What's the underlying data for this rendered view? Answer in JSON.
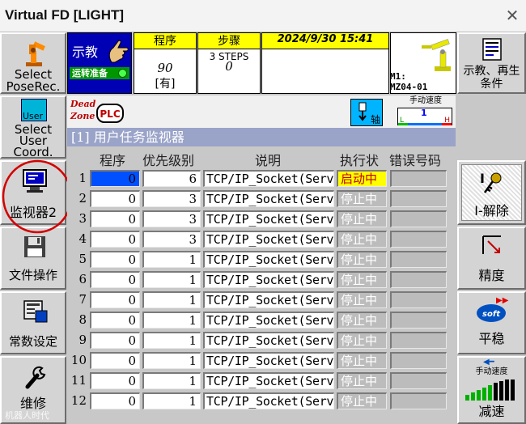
{
  "window": {
    "title": "Virtual FD [LIGHT]",
    "close_glyph": "✕"
  },
  "left_buttons": [
    {
      "label1": "Select",
      "label2": "PoseRec.",
      "icon": "robot-arm-icon"
    },
    {
      "label_icon": "User",
      "label1": "Select",
      "label2": "User",
      "label3": "Coord.",
      "icon": "user-coord-icon"
    },
    {
      "label1": "监视器2",
      "icon": "monitor-icon"
    },
    {
      "label1": "文件操作",
      "icon": "floppy-disk-icon"
    },
    {
      "label1": "常数设定",
      "icon": "constant-setting-icon"
    },
    {
      "label1": "维修",
      "icon": "wrench-icon"
    }
  ],
  "right_buttons": [
    {
      "label1": "示教、再生",
      "label2": "条件",
      "icon": "teach-condition-icon"
    },
    {
      "label1": "I-解除",
      "icon": "key-icon"
    },
    {
      "label1": "精度",
      "icon": "precision-icon"
    },
    {
      "label1": "平稳",
      "soft": "soft",
      "icon": "soft-icon"
    },
    {
      "label1": "手动速度",
      "label2": "减速",
      "icon": "speed-bars-icon"
    }
  ],
  "header": {
    "mode": "示教",
    "ready": "运转准备",
    "program_cap": "程序",
    "program_no": "90",
    "program_state": "[有]",
    "step_cap": "步骤",
    "steps": "3 STEPS",
    "step_no": "0",
    "datetime": "2024/9/30  15:41",
    "machine1": "M1:",
    "machine2": "MZ04-01"
  },
  "toolbar": {
    "deadzone1": "Dead",
    "deadzone2": "Zone",
    "plc": "PLC",
    "axis": "轴",
    "speed_label": "手动速度",
    "speed_l": "L",
    "speed_h": "H",
    "speed_value": "1"
  },
  "monitor": {
    "title": "[1] 用户任务监视器",
    "columns": {
      "program": "程序",
      "priority": "优先级别",
      "desc": "说明",
      "exec": "执行状",
      "err": "错误号码"
    },
    "rows": [
      {
        "n": "1",
        "program": "0",
        "priority": "6",
        "desc": "TCP/IP_Socket(Serv",
        "exec": "启动中",
        "err": ""
      },
      {
        "n": "2",
        "program": "0",
        "priority": "3",
        "desc": "TCP/IP_Socket(Serv",
        "exec": "停止中",
        "err": ""
      },
      {
        "n": "3",
        "program": "0",
        "priority": "3",
        "desc": "TCP/IP_Socket(Serv",
        "exec": "停止中",
        "err": ""
      },
      {
        "n": "4",
        "program": "0",
        "priority": "3",
        "desc": "TCP/IP_Socket(Serv",
        "exec": "停止中",
        "err": ""
      },
      {
        "n": "5",
        "program": "0",
        "priority": "1",
        "desc": "TCP/IP_Socket(Serv",
        "exec": "停止中",
        "err": ""
      },
      {
        "n": "6",
        "program": "0",
        "priority": "1",
        "desc": "TCP/IP_Socket(Serv",
        "exec": "停止中",
        "err": ""
      },
      {
        "n": "7",
        "program": "0",
        "priority": "1",
        "desc": "TCP/IP_Socket(Serv",
        "exec": "停止中",
        "err": ""
      },
      {
        "n": "8",
        "program": "0",
        "priority": "1",
        "desc": "TCP/IP_Socket(Serv",
        "exec": "停止中",
        "err": ""
      },
      {
        "n": "9",
        "program": "0",
        "priority": "1",
        "desc": "TCP/IP_Socket(Serv",
        "exec": "停止中",
        "err": ""
      },
      {
        "n": "10",
        "program": "0",
        "priority": "1",
        "desc": "TCP/IP_Socket(Serv",
        "exec": "停止中",
        "err": ""
      },
      {
        "n": "11",
        "program": "0",
        "priority": "1",
        "desc": "TCP/IP_Socket(Serv",
        "exec": "停止中",
        "err": ""
      },
      {
        "n": "12",
        "program": "0",
        "priority": "1",
        "desc": "TCP/IP_Socket(Serv",
        "exec": "停止中",
        "err": ""
      }
    ]
  },
  "watermark": "机器人时代",
  "colors": {
    "running": "#ffff00",
    "stopped": "#bcbcbc",
    "selected": "#0050ff",
    "title_bar": "#9aa3c8",
    "teach_bg": "#0000b4",
    "annotation": "#d40000"
  }
}
